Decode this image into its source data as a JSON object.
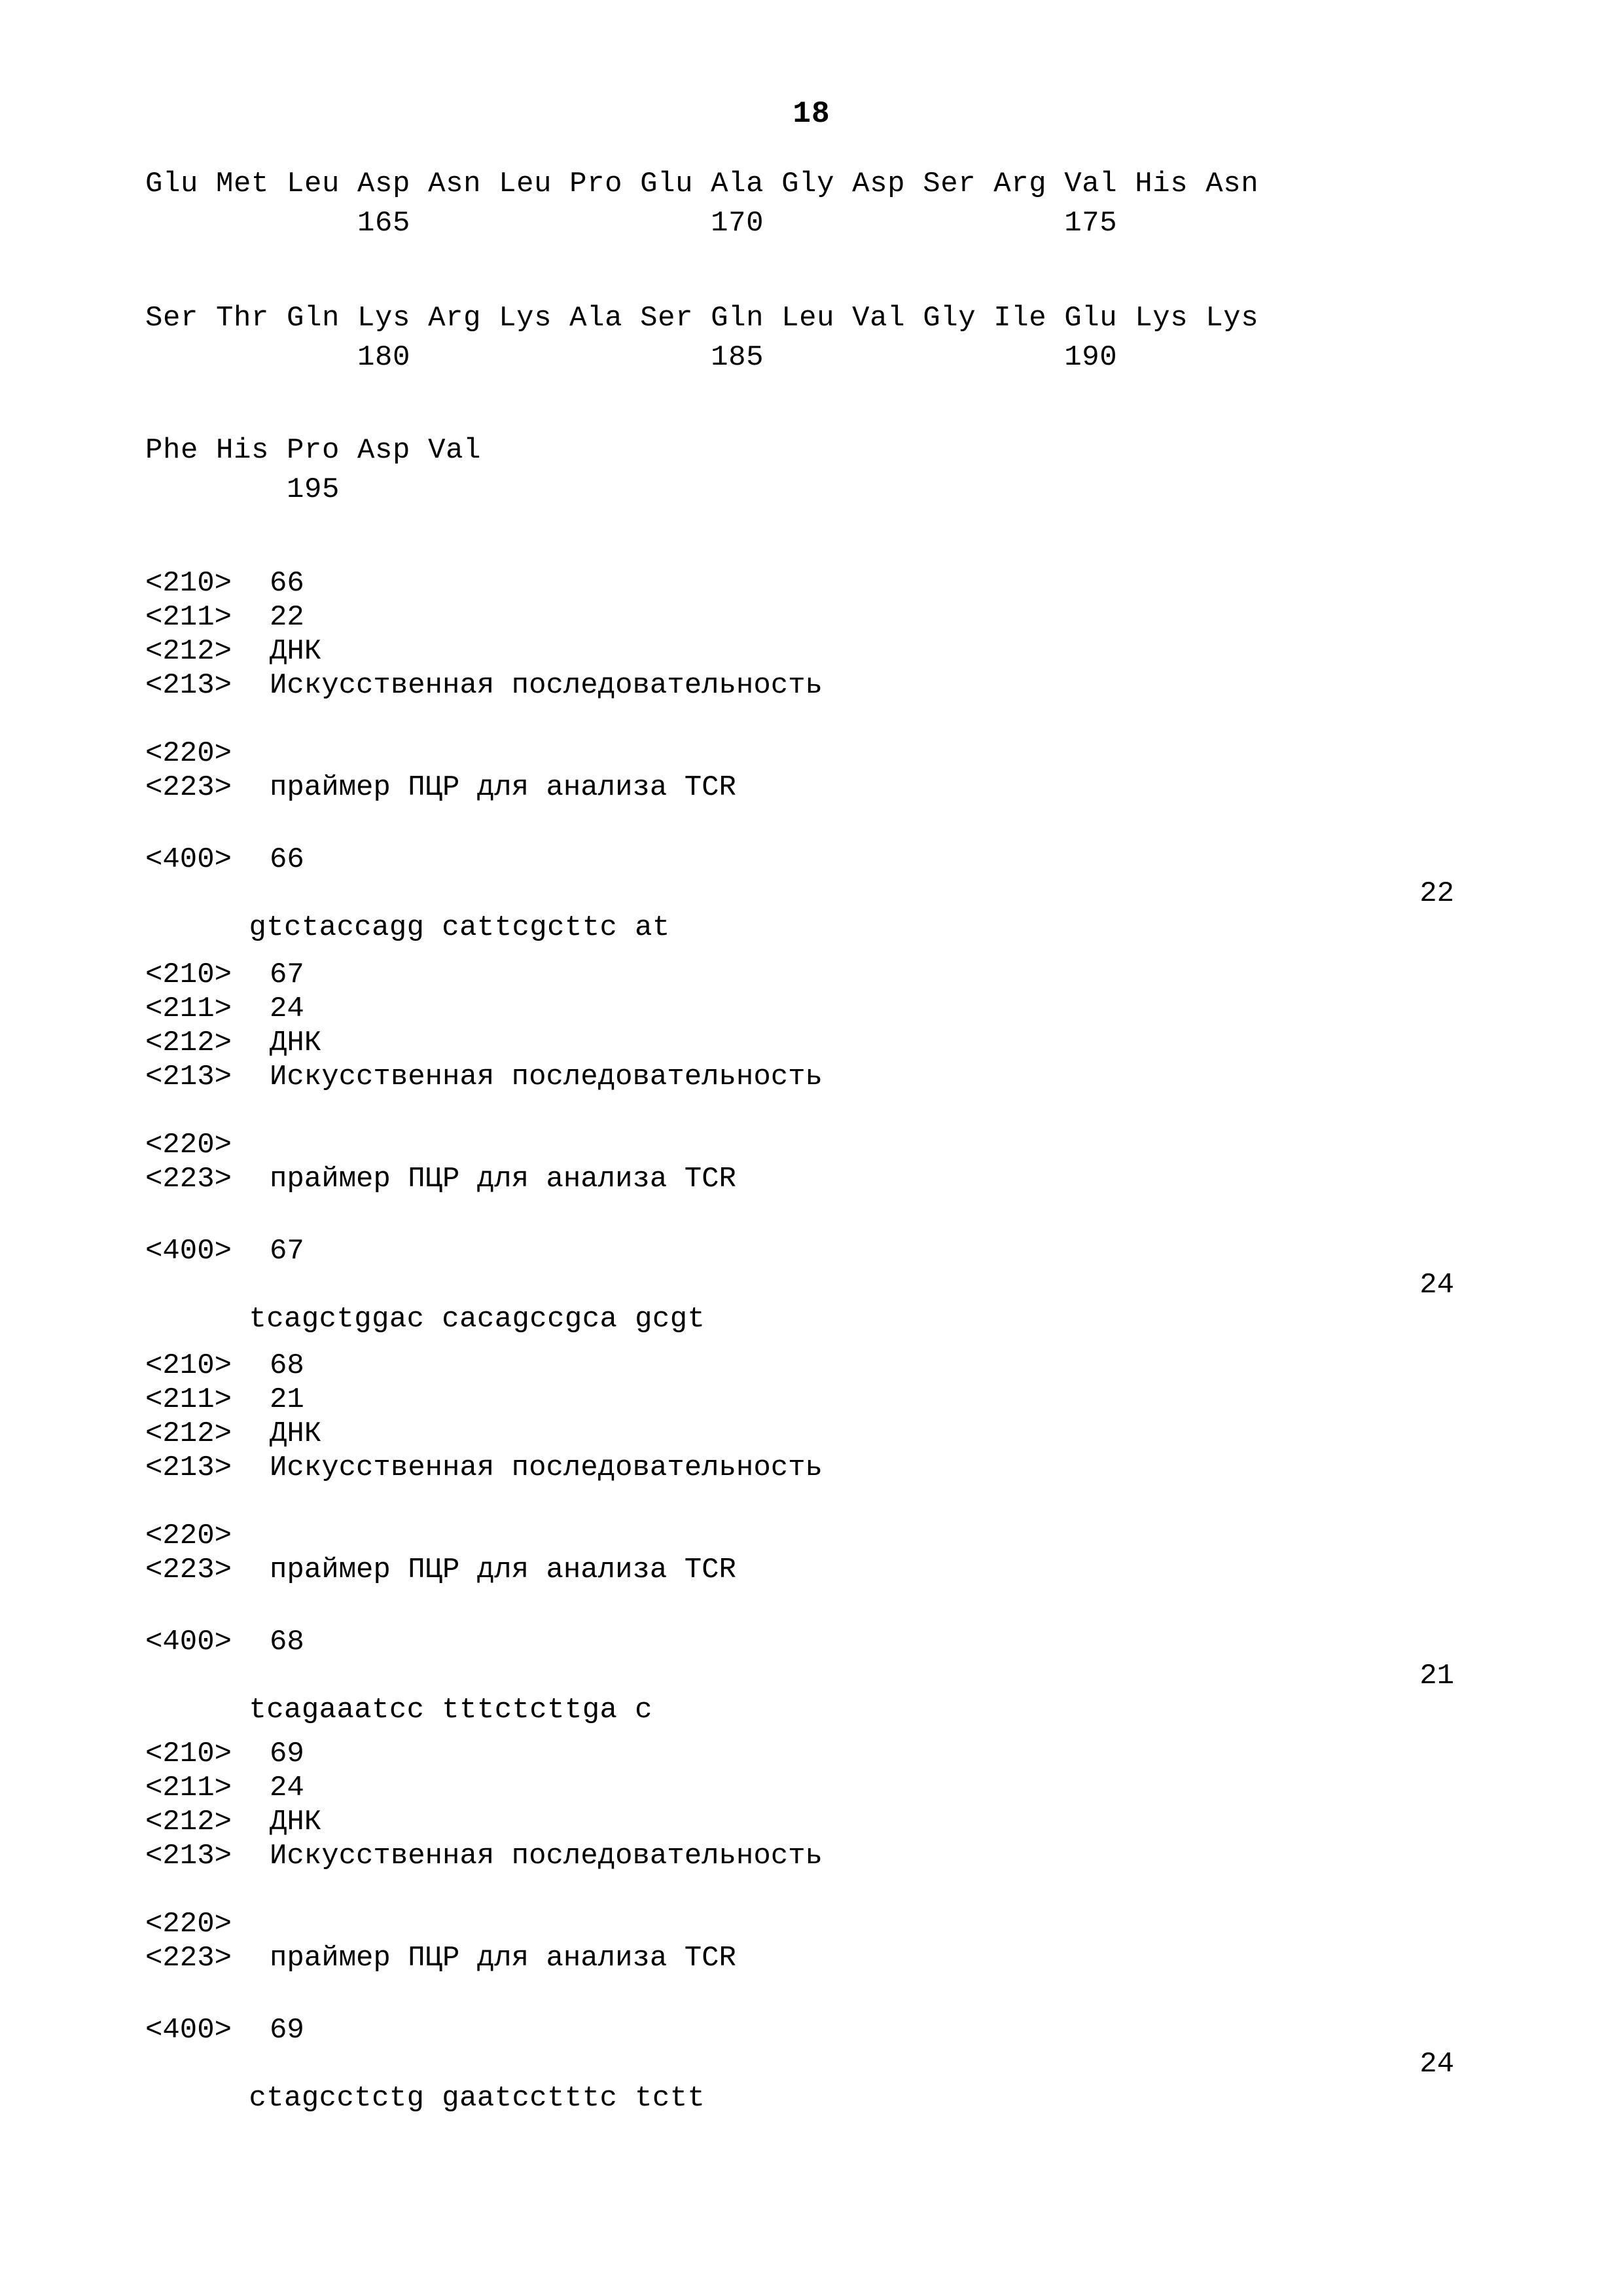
{
  "page": {
    "number": "18"
  },
  "amino_acid_blocks": [
    {
      "residues": "Glu Met Leu Asp Asn Leu Pro Glu Ala Gly Asp Ser Arg Val His Asn",
      "numbers": "            165                 170                 175"
    },
    {
      "residues": "Ser Thr Gln Lys Arg Lys Ala Ser Gln Leu Val Gly Ile Glu Lys Lys",
      "numbers": "            180                 185                 190"
    },
    {
      "residues": "Phe His Pro Asp Val",
      "numbers": "        195"
    }
  ],
  "sequence_blocks": [
    {
      "tag_210": "<210>",
      "id": "66",
      "tag_211": "<211>",
      "length": "22",
      "tag_212": "<212>",
      "molecule_type": "ДНК",
      "tag_213": "<213>",
      "organism": "Искусственная последовательность",
      "tag_220": "<220>",
      "tag_223": "<223>",
      "description": "праймер ПЦР для анализа TCR",
      "tag_400": "<400>",
      "sequence": "gtctaccagg cattcgcttc at",
      "sequence_length": "22"
    },
    {
      "tag_210": "<210>",
      "id": "67",
      "tag_211": "<211>",
      "length": "24",
      "tag_212": "<212>",
      "molecule_type": "ДНК",
      "tag_213": "<213>",
      "organism": "Искусственная последовательность",
      "tag_220": "<220>",
      "tag_223": "<223>",
      "description": "праймер ПЦР для анализа TCR",
      "tag_400": "<400>",
      "sequence": "tcagctggac cacagccgca gcgt",
      "sequence_length": "24"
    },
    {
      "tag_210": "<210>",
      "id": "68",
      "tag_211": "<211>",
      "length": "21",
      "tag_212": "<212>",
      "molecule_type": "ДНК",
      "tag_213": "<213>",
      "organism": "Искусственная последовательность",
      "tag_220": "<220>",
      "tag_223": "<223>",
      "description": "праймер ПЦР для анализа TCR",
      "tag_400": "<400>",
      "sequence": "tcagaaatcc tttctcttga c",
      "sequence_length": "21"
    },
    {
      "tag_210": "<210>",
      "id": "69",
      "tag_211": "<211>",
      "length": "24",
      "tag_212": "<212>",
      "molecule_type": "ДНК",
      "tag_213": "<213>",
      "organism": "Искусственная последовательность",
      "tag_220": "<220>",
      "tag_223": "<223>",
      "description": "праймер ПЦР для анализа TCR",
      "tag_400": "<400>",
      "sequence": "ctagcctctg gaatcctttc tctt",
      "sequence_length": "24"
    }
  ]
}
